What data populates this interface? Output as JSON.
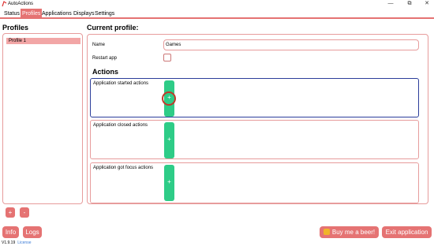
{
  "window": {
    "title": "AutoActions",
    "controls": {
      "minimize": "—",
      "maximize": "⧉",
      "close": "✕"
    }
  },
  "menu": [
    "Status",
    "Profiles",
    "Applications",
    "Displays",
    "Settings"
  ],
  "left": {
    "title": "Profiles",
    "profiles": [
      "Profile 1"
    ],
    "add_label": "+",
    "remove_label": "-",
    "info_label": "Info",
    "logs_label": "Logs",
    "version": "V1.9.19",
    "license": "License"
  },
  "right": {
    "title": "Current profile:",
    "name_label": "Name",
    "name_value": "Games",
    "restart_label": "Restart app",
    "actions_title": "Actions",
    "action_groups": [
      "Application started actions",
      "Application closed actions",
      "Application got focus actions"
    ],
    "add_action_label": "+"
  },
  "footer": {
    "beer_label": "Buy me a beer!",
    "exit_label": "Exit application"
  },
  "colors": {
    "accent": "#e57373",
    "add": "#2ecc87",
    "selection": "#2b3d9a"
  }
}
